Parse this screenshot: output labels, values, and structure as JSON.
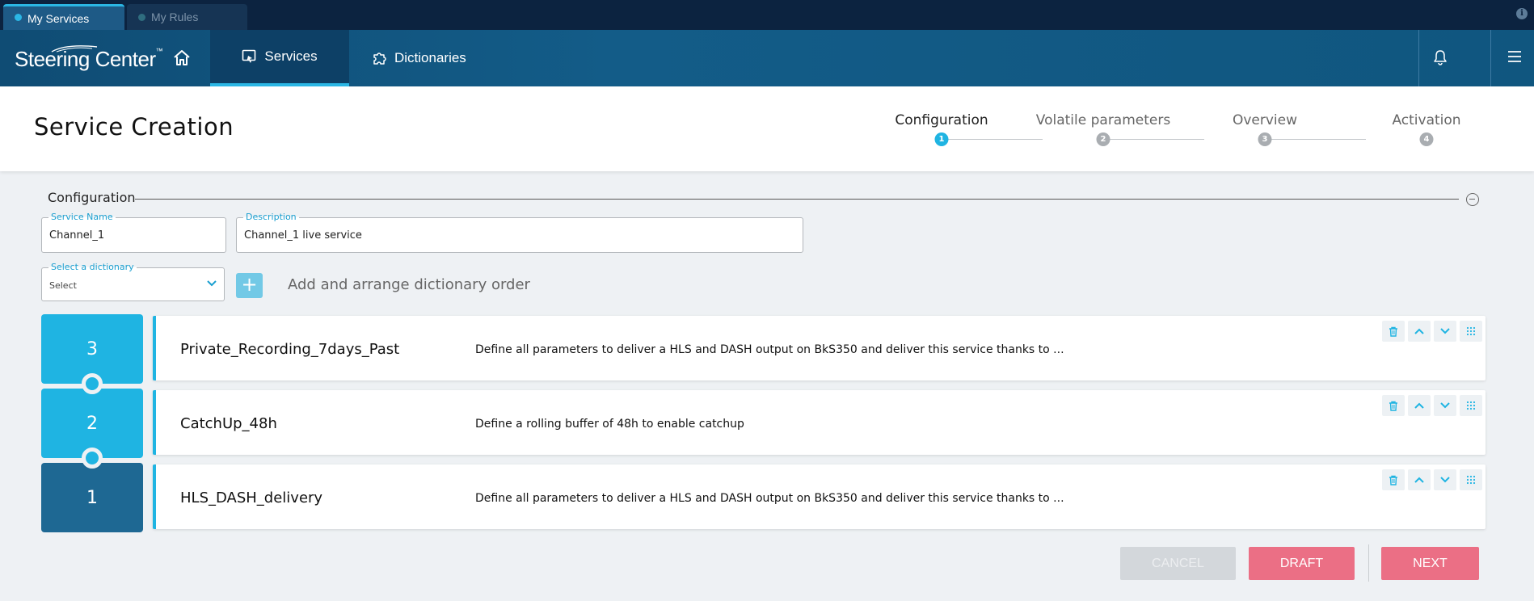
{
  "browser_tabs": [
    {
      "label": "My Services",
      "active": true
    },
    {
      "label": "My Rules",
      "active": false
    }
  ],
  "nav": {
    "logo": "Steering Center",
    "logo_tm": "™",
    "home_icon": "home-icon",
    "items": [
      {
        "label": "Services",
        "icon": "services-icon",
        "active": true
      },
      {
        "label": "Dictionaries",
        "icon": "puzzle-icon",
        "active": false
      }
    ],
    "bell_icon": "bell-icon",
    "menu_icon": "hamburger-menu-icon"
  },
  "page": {
    "title": "Service Creation"
  },
  "stepper": {
    "steps": [
      {
        "label": "Configuration",
        "number": "1",
        "active": true
      },
      {
        "label": "Volatile parameters",
        "number": "2",
        "active": false
      },
      {
        "label": "Overview",
        "number": "3",
        "active": false
      },
      {
        "label": "Activation",
        "number": "4",
        "active": false
      }
    ]
  },
  "config": {
    "section_title": "Configuration",
    "service_name": {
      "label": "Service Name",
      "value": "Channel_1"
    },
    "description": {
      "label": "Description",
      "value": "Channel_1 live service"
    },
    "dictionary_select": {
      "label": "Select a dictionary",
      "value": "Select"
    },
    "add_button": "+",
    "add_label": "Add and arrange dictionary order"
  },
  "dictionaries": [
    {
      "order": "3",
      "name": "Private_Recording_7days_Past",
      "description": "Define all parameters to deliver a HLS and DASH output on BkS350 and deliver this service thanks to ..."
    },
    {
      "order": "2",
      "name": "CatchUp_48h",
      "description": "Define a rolling buffer of 48h to enable catchup"
    },
    {
      "order": "1",
      "name": "HLS_DASH_delivery",
      "description": "Define all parameters to deliver a HLS and DASH output on BkS350 and deliver this service thanks to ..."
    }
  ],
  "footer": {
    "cancel": "CANCEL",
    "draft": "DRAFT",
    "next": "NEXT"
  },
  "colors": {
    "accent": "#1fb4e2",
    "dark_tile": "#1e6893",
    "primary_button": "#eb6f85",
    "disabled_button": "#d3d7db",
    "nav_bg": "#135c88"
  }
}
